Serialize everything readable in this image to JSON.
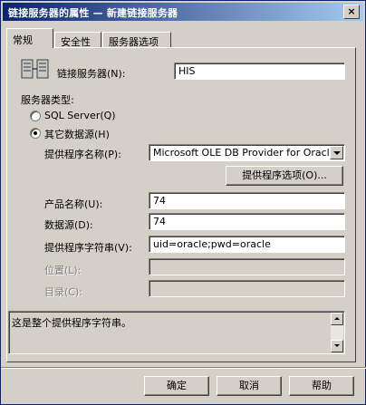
{
  "window": {
    "title": "链接服务器的属性 — 新建链接服务器",
    "close_label": "×"
  },
  "tabs": [
    {
      "label": "常规"
    },
    {
      "label": "安全性"
    },
    {
      "label": "服务器选项"
    }
  ],
  "form": {
    "linked_server_label": "链接服务器(N):",
    "linked_server_value": "HIS",
    "server_type_label": "服务器类型:",
    "radio_sql_server": {
      "label": "SQL Server(Q)",
      "checked": false
    },
    "radio_other_source": {
      "label": "其它数据源(H)",
      "checked": true
    },
    "provider_name_label": "提供程序名称(P):",
    "provider_name_value": "Microsoft OLE DB Provider for Oracle",
    "provider_options_button": "提供程序选项(O)...",
    "product_name_label": "产品名称(U):",
    "product_name_value": "74",
    "data_source_label": "数据源(D):",
    "data_source_value": "74",
    "provider_string_label": "提供程序字符串(V):",
    "provider_string_value": "uid=oracle;pwd=oracle",
    "location_label": "位置(L):",
    "location_value": "",
    "catalog_label": "目录(C):",
    "catalog_value": "",
    "description_text": "这是整个提供程序字符串。"
  },
  "footer": {
    "ok_button": "确定",
    "cancel_button": "取消",
    "help_button": "帮助"
  }
}
